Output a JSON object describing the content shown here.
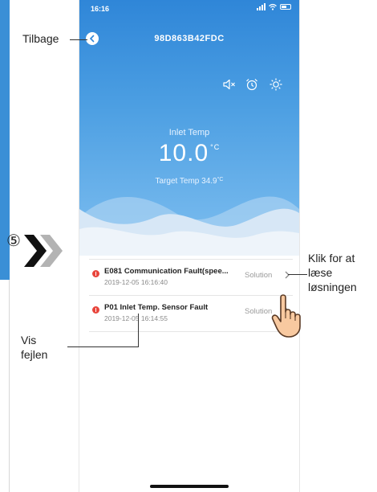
{
  "status_bar": {
    "time": "16:16"
  },
  "header": {
    "device_id": "98D863B42FDC"
  },
  "temps": {
    "inlet_label": "Inlet Temp",
    "inlet_value": "10.0",
    "inlet_unit": "°C",
    "target_label": "Target Temp",
    "target_value": "34.9",
    "target_unit": "°C"
  },
  "faults": [
    {
      "title": "E081 Communication Fault(spee...",
      "time": "2019-12-05 16:16:40",
      "action": "Solution"
    },
    {
      "title": "P01 Inlet Temp. Sensor Fault",
      "time": "2019-12-05 16:14:55",
      "action": "Solution"
    }
  ],
  "annotations": {
    "back": "Tilbage",
    "step": "⑤",
    "click_solution": [
      "Klik for at",
      "læse",
      "løsningen"
    ],
    "show_fault": [
      "Vis",
      "fejlen"
    ]
  },
  "icons": [
    "mute-icon",
    "alarm-clock-icon",
    "sun-icon",
    "back-arrow-icon",
    "chevron-right-icon",
    "hand-pointer-icon"
  ],
  "colors": {
    "hero_top": "#2f86d8",
    "fault_red": "#e8453c",
    "wave": "#dfeaf6"
  }
}
